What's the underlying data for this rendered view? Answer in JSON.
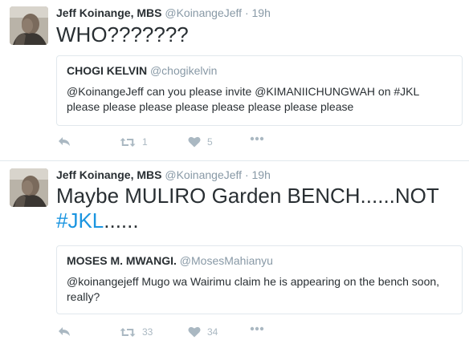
{
  "colors": {
    "text": "#292f33",
    "secondary": "#8899a6",
    "hashtag": "#1b95e0",
    "action_icons": "#aab8c2",
    "border": "#e1e8ed"
  },
  "tweets": [
    {
      "fullname": "Jeff Koinange, MBS",
      "handle": "@KoinangeJeff",
      "separator": "·",
      "time": "19h",
      "text": "WHO???????",
      "quote": {
        "name": "CHOGI KELVIN",
        "handle": "@chogikelvin",
        "text": "@KoinangeJeff can you please invite  @KIMANIICHUNGWAH on #JKL please please please please please please please please"
      },
      "actions": {
        "reply_icon": "reply-icon",
        "retweet_icon": "retweet-icon",
        "retweets": "1",
        "like_icon": "heart-icon",
        "likes": "5",
        "more_icon": "more-icon"
      }
    },
    {
      "fullname": "Jeff Koinange, MBS",
      "handle": "@KoinangeJeff",
      "separator": "·",
      "time": "19h",
      "text_main": "Maybe MULIRO Garden BENCH......NOT ",
      "text_hashtag": "#JKL",
      "text_tail": "......",
      "quote": {
        "name": "MOSES M. MWANGI.",
        "handle": "@MosesMahianyu",
        "text": "@koinangejeff Mugo wa Wairimu claim he is appearing on the bench soon, really?"
      },
      "actions": {
        "reply_icon": "reply-icon",
        "retweet_icon": "retweet-icon",
        "retweets": "33",
        "like_icon": "heart-icon",
        "likes": "34",
        "more_icon": "more-icon"
      }
    }
  ]
}
